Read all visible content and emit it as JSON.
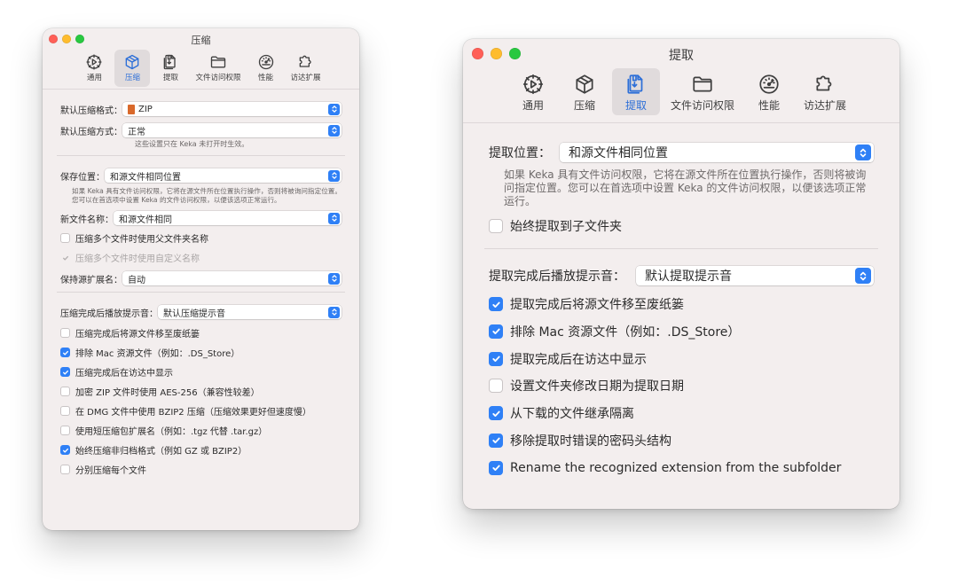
{
  "colors": {
    "accent": "#2f80f6",
    "close": "#ff5f57",
    "minimize": "#febc2e",
    "zoom": "#28c840",
    "window_bg": "#f3eeee"
  },
  "left_window": {
    "title": "压缩",
    "tabs": [
      {
        "label": "通用",
        "icon": "gear-icon"
      },
      {
        "label": "压缩",
        "icon": "cube-icon"
      },
      {
        "label": "提取",
        "icon": "extract-doc-icon"
      },
      {
        "label": "文件访问权限",
        "icon": "folder-icon"
      },
      {
        "label": "性能",
        "icon": "gauge-icon"
      },
      {
        "label": "访达扩展",
        "icon": "puzzle-icon"
      }
    ],
    "active_tab": "压缩",
    "format": {
      "label": "默认压缩格式：",
      "value": "ZIP"
    },
    "method": {
      "label": "默认压缩方式：",
      "value": "正常"
    },
    "method_note": "这些设置只在 Keka 未打开时生效。",
    "save_location": {
      "label": "保存位置：",
      "value": "和源文件相同位置"
    },
    "save_note": "如果 Keka 具有文件访问权限，它将在源文件所在位置执行操作，否则将被询问指定位置。您可以在首选项中设置 Keka 的文件访问权限，以便该选项正常运行。",
    "new_name": {
      "label": "新文件名称：",
      "value": "和源文件相同"
    },
    "name_options": [
      {
        "label": "压缩多个文件时使用父文件夹名称",
        "state": "unchecked"
      },
      {
        "label": "压缩多个文件时使用自定义名称",
        "state": "disabled"
      }
    ],
    "keep_ext": {
      "label": "保持源扩展名：",
      "value": "自动"
    },
    "sound": {
      "label": "压缩完成后播放提示音：",
      "value": "默认压缩提示音"
    },
    "options": [
      {
        "label": "压缩完成后将源文件移至废纸篓",
        "checked": false
      },
      {
        "label": "排除 Mac 资源文件（例如：.DS_Store）",
        "checked": true
      },
      {
        "label": "压缩完成后在访达中显示",
        "checked": true
      },
      {
        "label": "加密 ZIP 文件时使用 AES-256（兼容性较差）",
        "checked": false
      },
      {
        "label": "在 DMG 文件中使用 BZIP2 压缩（压缩效果更好但速度慢）",
        "checked": false
      },
      {
        "label": "使用短压缩包扩展名（例如：.tgz 代替 .tar.gz）",
        "checked": false
      },
      {
        "label": "始终压缩非归档格式（例如 GZ 或 BZIP2）",
        "checked": true
      },
      {
        "label": "分别压缩每个文件",
        "checked": false
      }
    ]
  },
  "right_window": {
    "title": "提取",
    "tabs": [
      {
        "label": "通用",
        "icon": "gear-icon"
      },
      {
        "label": "压缩",
        "icon": "cube-icon"
      },
      {
        "label": "提取",
        "icon": "extract-doc-icon"
      },
      {
        "label": "文件访问权限",
        "icon": "folder-icon"
      },
      {
        "label": "性能",
        "icon": "gauge-icon"
      },
      {
        "label": "访达扩展",
        "icon": "puzzle-icon"
      }
    ],
    "active_tab": "提取",
    "location": {
      "label": "提取位置：",
      "value": "和源文件相同位置"
    },
    "location_note": "如果 Keka 具有文件访问权限，它将在源文件所在位置执行操作，否则将被询问指定位置。您可以在首选项中设置 Keka 的文件访问权限，以便该选项正常运行。",
    "subfolder": {
      "label": "始终提取到子文件夹",
      "checked": false
    },
    "sound": {
      "label": "提取完成后播放提示音：",
      "value": "默认提取提示音"
    },
    "options": [
      {
        "label": "提取完成后将源文件移至废纸篓",
        "checked": true
      },
      {
        "label": "排除 Mac 资源文件（例如：.DS_Store）",
        "checked": true
      },
      {
        "label": "提取完成后在访达中显示",
        "checked": true
      },
      {
        "label": "设置文件夹修改日期为提取日期",
        "checked": false
      },
      {
        "label": "从下载的文件继承隔离",
        "checked": true
      },
      {
        "label": "移除提取时错误的密码头结构",
        "checked": true
      },
      {
        "label": "Rename the recognized extension from the subfolder",
        "checked": true
      }
    ]
  }
}
